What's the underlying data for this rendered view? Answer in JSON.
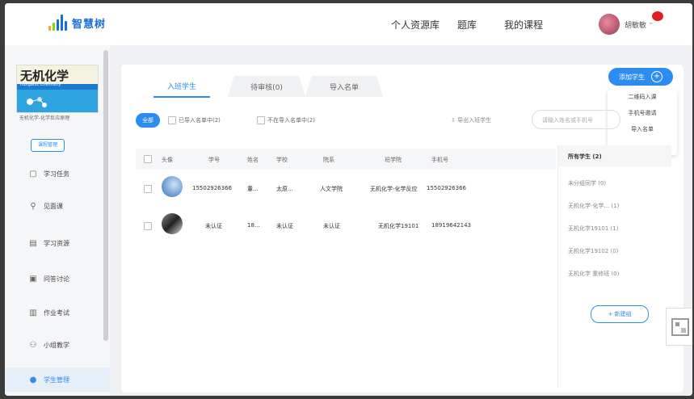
{
  "header": {
    "logo_text": "智慧树",
    "nav": [
      "个人资源库",
      "题库",
      "我的课程"
    ],
    "user_name": "胡敏敏"
  },
  "sidebar": {
    "course_cover_title": "无机化学",
    "course_cover_subtitle": "Inorganic Chemistry",
    "course_name": "无机化学-化学反应原理",
    "course_button": "课程管理",
    "items": [
      {
        "label": "学习任务",
        "icon": "task-icon"
      },
      {
        "label": "见面课",
        "icon": "person-icon"
      },
      {
        "label": "学习资源",
        "icon": "resource-icon"
      },
      {
        "label": "问答讨论",
        "icon": "discussion-icon"
      },
      {
        "label": "作业考试",
        "icon": "exam-icon"
      },
      {
        "label": "小组教学",
        "icon": "group-icon"
      },
      {
        "label": "学生管理",
        "icon": "student-icon",
        "active": true
      }
    ]
  },
  "main": {
    "tabs": [
      "入班学生",
      "待审核(0)",
      "导入名单"
    ],
    "add_button": "添加学生",
    "dropdown": [
      "二维码入课",
      "手机号邀请",
      "导入名单"
    ],
    "filter": {
      "all": "全部",
      "opt1": "已导入名单中(2)",
      "opt2": "不在导入名单中(2)",
      "export": "导出入班学生",
      "search_placeholder": "请输入姓名或手机号"
    },
    "columns": [
      "全选",
      "头像",
      "学号",
      "姓名",
      "学校",
      "院系",
      "班学院",
      "手机号"
    ],
    "rows": [
      {
        "id": "15502926366",
        "name": "董...",
        "school": "太原...",
        "dept": "人文学院",
        "class": "无机化学-化学反应",
        "phone": "15502926366"
      },
      {
        "id": "未认证",
        "name": "18...",
        "school": "未认证",
        "dept": "未认证",
        "class": "无机化学19101",
        "phone": "18919642143"
      }
    ]
  },
  "groups": {
    "items": [
      "所有学生 (2)",
      "未分组同学 (0)",
      "无机化学-化学... (1)",
      "无机化学19101 (1)",
      "无机化学19102 (0)",
      "无机化学 重修班 (0)"
    ],
    "new_group": "+ 新建组"
  },
  "colors": {
    "accent": "#2d8cf0"
  }
}
